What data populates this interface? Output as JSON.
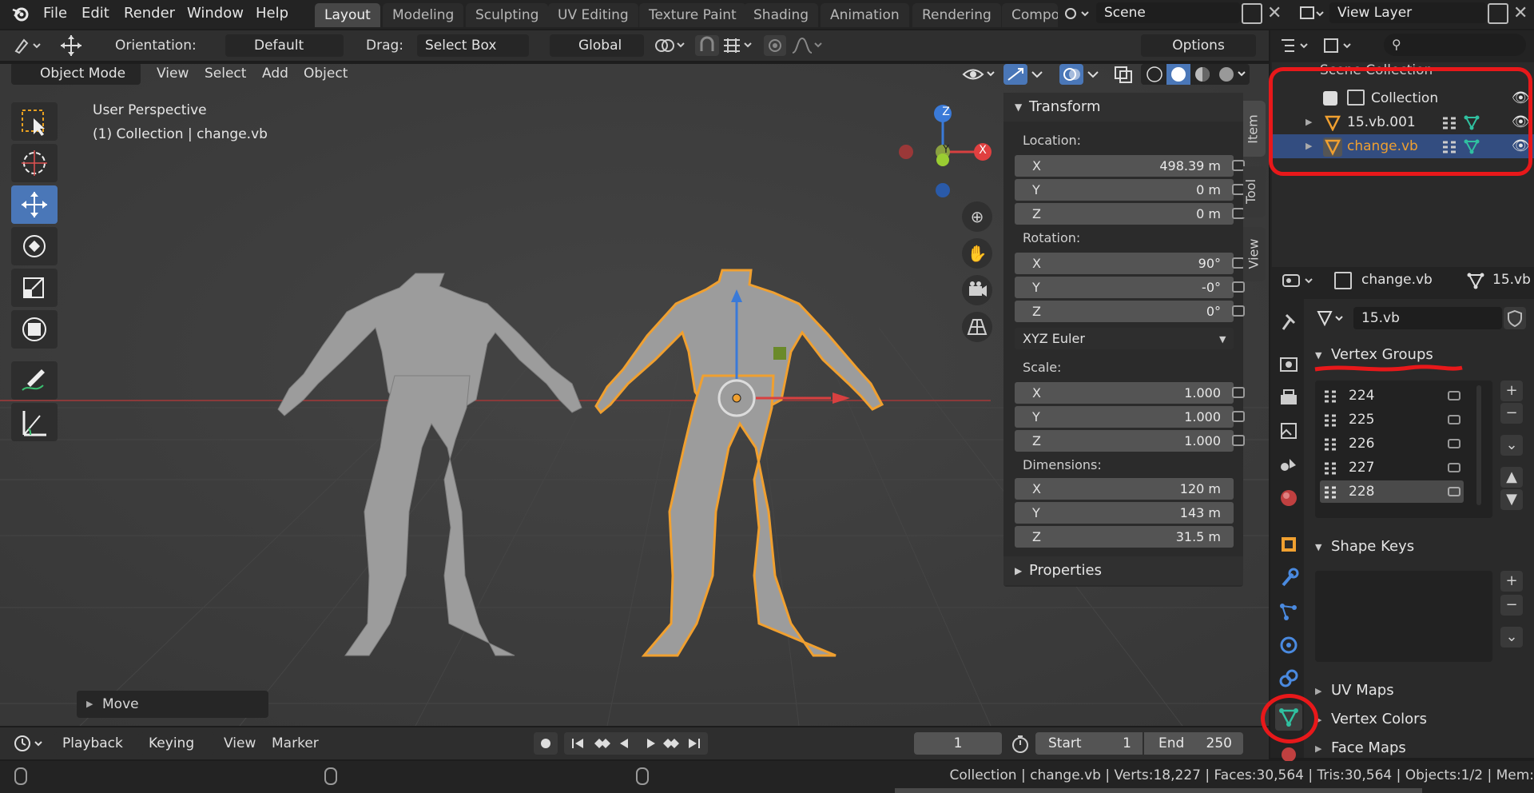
{
  "menu": {
    "items": [
      "File",
      "Edit",
      "Render",
      "Window",
      "Help"
    ]
  },
  "workspaces": {
    "tabs": [
      "Layout",
      "Modeling",
      "Sculpting",
      "UV Editing",
      "Texture Paint",
      "Shading",
      "Animation",
      "Rendering",
      "Compo"
    ],
    "active": "Layout"
  },
  "scene": {
    "label": "Scene",
    "view_layer": "View Layer"
  },
  "tool_header": {
    "orientation_label": "Orientation:",
    "orientation_value": "Default",
    "drag_label": "Drag:",
    "drag_value": "Select Box",
    "transform_value": "Global",
    "options_label": "Options"
  },
  "viewport_header": {
    "mode": "Object Mode",
    "menus": [
      "View",
      "Select",
      "Add",
      "Object"
    ]
  },
  "viewport": {
    "perspective": "User Perspective",
    "context": "(1) Collection | change.vb",
    "gizmo_axes": [
      "X",
      "Y",
      "Z"
    ]
  },
  "transform_panel": {
    "title": "Transform",
    "location_label": "Location:",
    "location": [
      {
        "axis": "X",
        "value": "498.39 m"
      },
      {
        "axis": "Y",
        "value": "0 m"
      },
      {
        "axis": "Z",
        "value": "0 m"
      }
    ],
    "rotation_label": "Rotation:",
    "rotation": [
      {
        "axis": "X",
        "value": "90°"
      },
      {
        "axis": "Y",
        "value": "-0°"
      },
      {
        "axis": "Z",
        "value": "0°"
      }
    ],
    "rotation_mode": "XYZ Euler",
    "scale_label": "Scale:",
    "scale": [
      {
        "axis": "X",
        "value": "1.000"
      },
      {
        "axis": "Y",
        "value": "1.000"
      },
      {
        "axis": "Z",
        "value": "1.000"
      }
    ],
    "dimensions_label": "Dimensions:",
    "dimensions": [
      {
        "axis": "X",
        "value": "120 m"
      },
      {
        "axis": "Y",
        "value": "143 m"
      },
      {
        "axis": "Z",
        "value": "31.5 m"
      }
    ],
    "properties_label": "Properties"
  },
  "sidebar_tabs": [
    "Item",
    "Tool",
    "View"
  ],
  "last_op": {
    "label": "Move"
  },
  "outliner": {
    "search_placeholder": "",
    "scene_collection": "Scene Collection",
    "rows": [
      "Collection",
      "15.vb.001",
      "change.vb"
    ]
  },
  "properties": {
    "object_name": "change.vb",
    "mesh_name": "15.vb",
    "data_block": "15.vb",
    "vertex_groups_title": "Vertex Groups",
    "vertex_groups": [
      "224",
      "225",
      "226",
      "227",
      "228"
    ],
    "shape_keys_title": "Shape Keys",
    "uv_maps_title": "UV Maps",
    "vertex_colors_title": "Vertex Colors",
    "face_maps_title": "Face Maps"
  },
  "timeline": {
    "menus": [
      "Playback",
      "Keying",
      "View",
      "Marker"
    ],
    "current_frame": "1",
    "start_label": "Start",
    "start": "1",
    "end_label": "End",
    "end": "250"
  },
  "status": {
    "text": "Collection | change.vb | Verts:18,227 | Faces:30,564 | Tris:30,564 | Objects:1/2 | Mem:"
  },
  "colors": {
    "accent": "#4a77b8",
    "selection": "#f0a030",
    "annotation": "#e8181a"
  }
}
